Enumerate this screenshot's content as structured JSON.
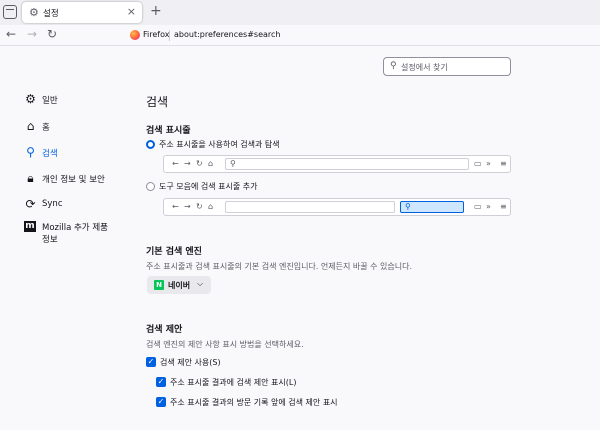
{
  "tabstrip": {
    "tab_title": "설정",
    "icons": {
      "tab_list": "tab-list-icon",
      "tab_settings": "gear-icon",
      "close": "close-icon",
      "new_tab": "plus-icon"
    }
  },
  "navbar": {
    "icons": {
      "back": "back-arrow-icon",
      "forward": "forward-arrow-icon",
      "reload": "reload-icon"
    },
    "identity_label": "Firefox",
    "url": "about:preferences#search"
  },
  "pref_search": {
    "placeholder": "설정에서 찾기"
  },
  "sidebar": {
    "items": [
      {
        "label": "일반",
        "icon": "gear-icon"
      },
      {
        "label": "홈",
        "icon": "home-icon"
      },
      {
        "label": "검색",
        "icon": "search-icon",
        "active": true
      },
      {
        "label": "개인 정보 및 보안",
        "icon": "lock-icon"
      },
      {
        "label": "Sync",
        "icon": "sync-icon"
      },
      {
        "label_line1": "Mozilla 추가 제품",
        "label_line2": "정보",
        "icon": "mozilla-icon"
      }
    ]
  },
  "main": {
    "title": "검색",
    "search_bar": {
      "heading": "검색 표시줄",
      "option_address": "주소 표시줄을 사용하여 검색과 탐색",
      "option_toolbar": "도구 모음에 검색 표시줄 추가",
      "selected": "address"
    },
    "default_engine": {
      "heading": "기본 검색 엔진",
      "description": "주소 표시줄과 검색 표시줄의 기본 검색 엔진입니다. 언제든지 바꿀 수 있습니다.",
      "engine_name": "네이버",
      "engine_logo_text": "N"
    },
    "suggestions": {
      "heading": "검색 제안",
      "description": "검색 엔진의 제안 사항 표시 방법을 선택하세요.",
      "use_suggestions": "검색 제안 사용(S)",
      "show_in_address": "주소 표시줄 결과에 검색 제안 표시(L)",
      "show_ahead_history": "주소 표시줄 결과의 방문 기록 앞에 검색 제안 표시",
      "checked": {
        "use_suggestions": true,
        "show_in_address": true,
        "show_ahead_history": true
      }
    }
  },
  "colors": {
    "accent": "#0061e0",
    "background": "#f9f9fb",
    "text": "#15141a",
    "muted": "#5b5b66",
    "naver": "#03c75a"
  }
}
